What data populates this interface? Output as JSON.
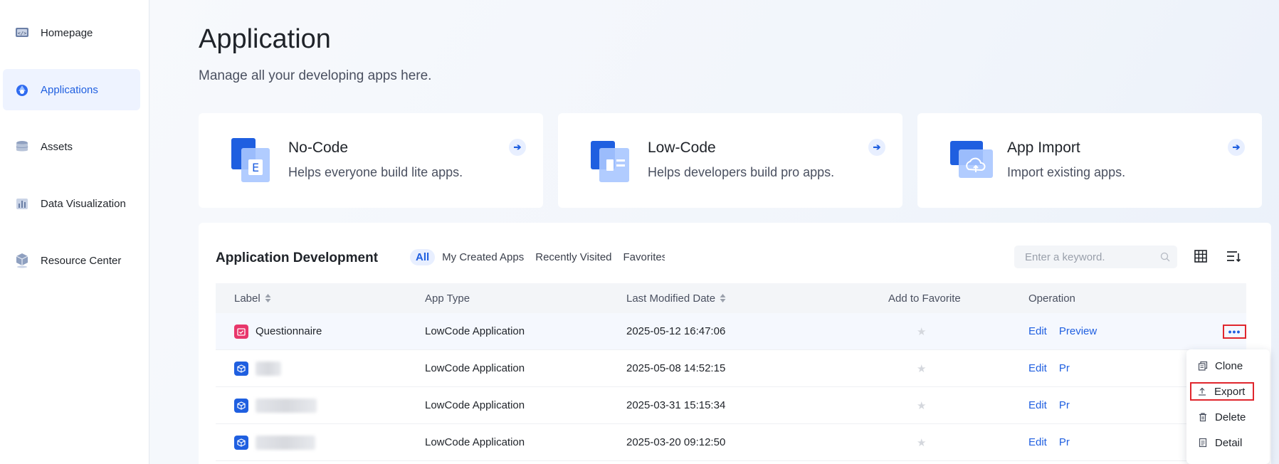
{
  "sidebar": {
    "items": [
      {
        "label": "Homepage",
        "icon": "code-window-icon",
        "active": false
      },
      {
        "label": "Applications",
        "icon": "applications-icon",
        "active": true
      },
      {
        "label": "Assets",
        "icon": "database-icon",
        "active": false
      },
      {
        "label": "Data Visualization",
        "icon": "bar-chart-icon",
        "active": false
      },
      {
        "label": "Resource Center",
        "icon": "cube-icon",
        "active": false
      }
    ]
  },
  "header": {
    "title": "Application",
    "subtitle": "Manage all your developing apps here."
  },
  "cards": [
    {
      "title": "No-Code",
      "description": "Helps everyone build lite apps.",
      "icon": "no-code-icon"
    },
    {
      "title": "Low-Code",
      "description": "Helps developers build pro apps.",
      "icon": "low-code-icon"
    },
    {
      "title": "App Import",
      "description": "Import existing apps.",
      "icon": "cloud-import-icon"
    }
  ],
  "panel": {
    "title": "Application Development",
    "tabs": [
      "All",
      "My Created Apps",
      "Recently Visited",
      "Favorites"
    ],
    "active_tab": "All",
    "search": {
      "placeholder": "Enter a keyword.",
      "value": ""
    }
  },
  "table": {
    "columns": {
      "label": "Label",
      "app_type": "App Type",
      "modified": "Last Modified Date",
      "favorite": "Add to Favorite",
      "operation": "Operation"
    },
    "rows": [
      {
        "label": "Questionnaire",
        "app_type": "LowCode Application",
        "modified": "2025-05-12 16:47:06",
        "edit": "Edit",
        "preview": "Preview",
        "more": "•••"
      },
      {
        "label": "",
        "app_type": "LowCode Application",
        "modified": "2025-05-08 14:52:15",
        "edit": "Edit",
        "preview": "Pr"
      },
      {
        "label": "",
        "app_type": "LowCode Application",
        "modified": "2025-03-31 15:15:34",
        "edit": "Edit",
        "preview": "Pr"
      },
      {
        "label": "",
        "app_type": "LowCode Application",
        "modified": "2025-03-20 09:12:50",
        "edit": "Edit",
        "preview": "Pr"
      }
    ]
  },
  "menu": {
    "items": [
      {
        "label": "Clone",
        "icon": "copy-icon"
      },
      {
        "label": "Export",
        "icon": "upload-icon",
        "highlighted": true
      },
      {
        "label": "Delete",
        "icon": "trash-icon"
      },
      {
        "label": "Detail",
        "icon": "document-icon"
      }
    ]
  },
  "colors": {
    "accent": "#1f5fe0",
    "highlight_border": "#e0262d",
    "active_nav_bg": "#eef3ff"
  }
}
